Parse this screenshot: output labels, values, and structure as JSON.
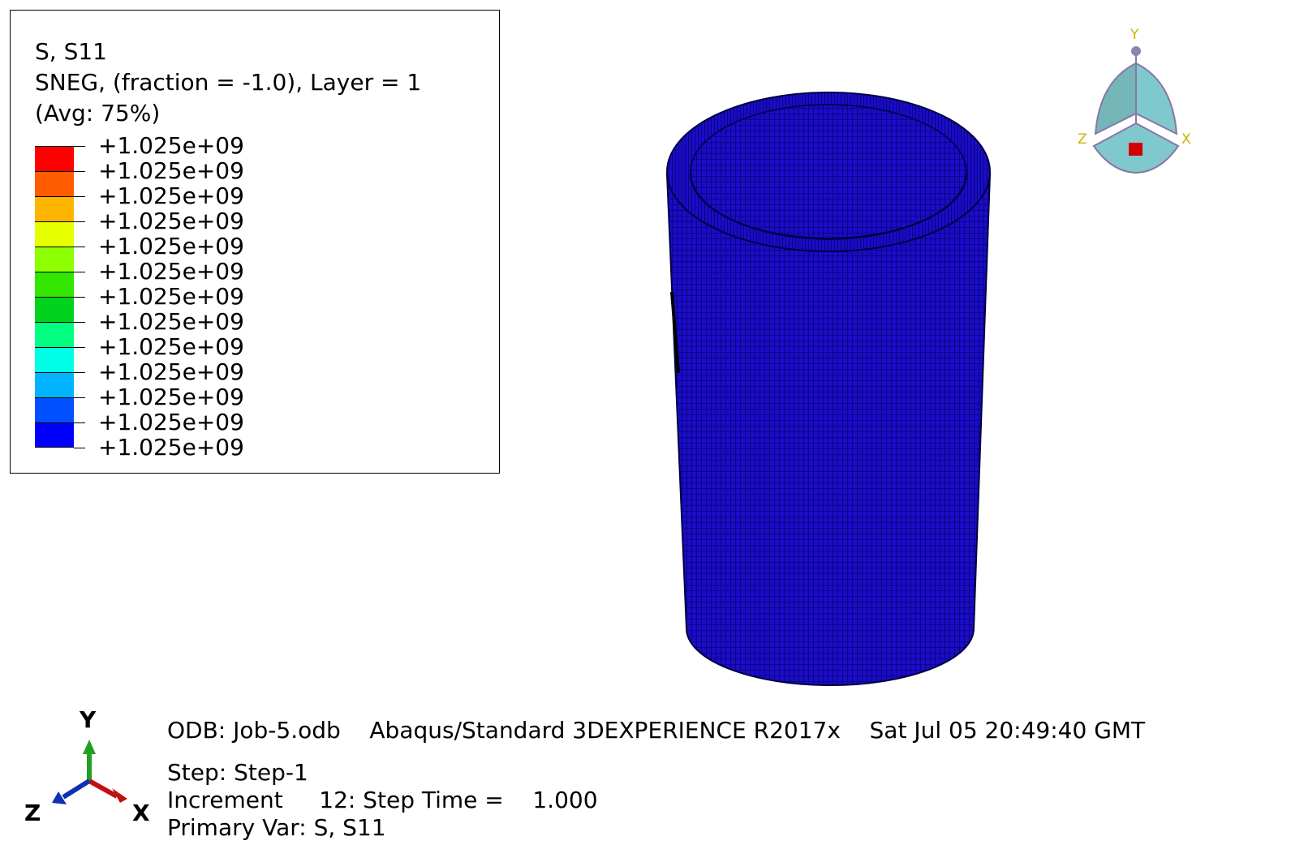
{
  "legend": {
    "title_line1": "S, S11",
    "title_line2": "SNEG, (fraction = -1.0), Layer = 1",
    "title_line3": "(Avg: 75%)",
    "colors": [
      "#ff0000",
      "#ff5c00",
      "#ffb400",
      "#e6ff00",
      "#8cff00",
      "#32e600",
      "#00d21e",
      "#00ff80",
      "#00ffe6",
      "#00b4ff",
      "#0050ff",
      "#0000ff"
    ],
    "tick_labels": [
      "+1.025e+09",
      "+1.025e+09",
      "+1.025e+09",
      "+1.025e+09",
      "+1.025e+09",
      "+1.025e+09",
      "+1.025e+09",
      "+1.025e+09",
      "+1.025e+09",
      "+1.025e+09",
      "+1.025e+09",
      "+1.025e+09",
      "+1.025e+09"
    ]
  },
  "model": {
    "fill_color": "#1a0cc8",
    "mesh_color": "#000060"
  },
  "view_cube": {
    "y_label": "Y",
    "z_label": "Z",
    "x_label": "X"
  },
  "info": {
    "odb_line": "ODB: Job-5.odb    Abaqus/Standard 3DEXPERIENCE R2017x    Sat Jul 05 20:49:40 GMT",
    "step_line": "Step: Step-1",
    "increment_line": "Increment     12: Step Time =    1.000",
    "primary_var_line": "Primary Var: S, S11"
  },
  "triad": {
    "y_label": "Y",
    "z_label": "Z",
    "x_label": "X"
  }
}
